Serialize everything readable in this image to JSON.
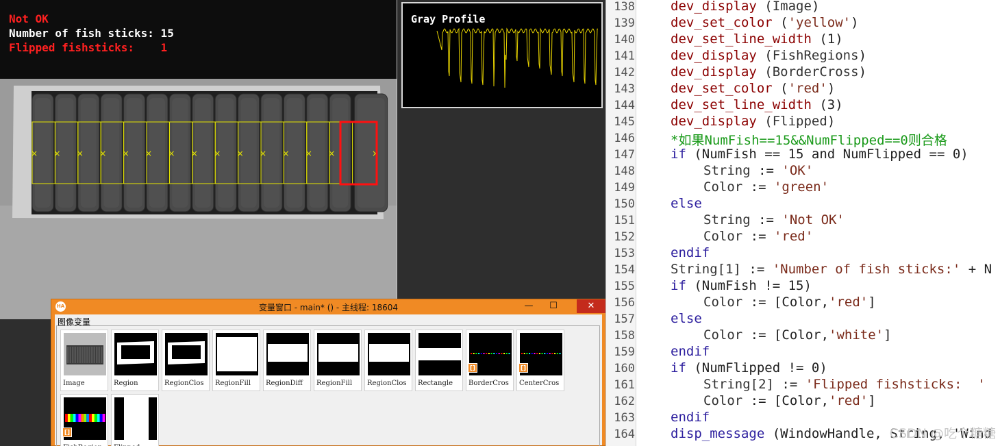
{
  "image_window": {
    "overlay_lines": [
      {
        "text": "Not OK",
        "color": "#ff2020"
      },
      {
        "text": "Number of fish sticks: 15",
        "color": "#ffffff"
      },
      {
        "text": "Flipped fishsticks:    1",
        "color": "#ff2020"
      }
    ],
    "fish_count": 15,
    "flipped_index": 14
  },
  "gray_profile": {
    "title": "Gray Profile",
    "line_color": "#e6d200"
  },
  "variable_window": {
    "title": "变量窗口 - main* () - 主线程: 18604",
    "minimize": "—",
    "maximize": "☐",
    "close": "✕",
    "group_label": "图像变量",
    "variables": [
      {
        "name": "Image",
        "kind": "image"
      },
      {
        "name": "Region",
        "kind": "region-small"
      },
      {
        "name": "RegionClos",
        "kind": "region-small"
      },
      {
        "name": "RegionFill",
        "kind": "region-big"
      },
      {
        "name": "RegionDiff",
        "kind": "band"
      },
      {
        "name": "RegionFill",
        "kind": "band"
      },
      {
        "name": "RegionClos",
        "kind": "band"
      },
      {
        "name": "Rectangle",
        "kind": "band-narrow"
      },
      {
        "name": "BorderCros",
        "kind": "dots",
        "badge": "[]"
      },
      {
        "name": "CenterCros",
        "kind": "dots",
        "badge": "[]"
      },
      {
        "name": "FishRegion",
        "kind": "colors",
        "badge": "[]"
      },
      {
        "name": "Flipped",
        "kind": "flipped"
      }
    ]
  },
  "editor": {
    "lines": [
      {
        "num": "138",
        "indent": 0,
        "parts": [
          [
            "fn",
            "dev_display"
          ],
          [
            "op",
            " ("
          ],
          [
            "var",
            "Image"
          ],
          [
            "op",
            ")"
          ]
        ]
      },
      {
        "num": "139",
        "indent": 0,
        "parts": [
          [
            "fn",
            "dev_set_color"
          ],
          [
            "op",
            " ("
          ],
          [
            "str",
            "'yellow'"
          ],
          [
            "op",
            ")"
          ]
        ]
      },
      {
        "num": "140",
        "indent": 0,
        "parts": [
          [
            "fn",
            "dev_set_line_width"
          ],
          [
            "op",
            " (1)"
          ]
        ]
      },
      {
        "num": "141",
        "indent": 0,
        "parts": [
          [
            "fn",
            "dev_display"
          ],
          [
            "op",
            " ("
          ],
          [
            "var",
            "FishRegions"
          ],
          [
            "op",
            ")"
          ]
        ]
      },
      {
        "num": "142",
        "indent": 0,
        "parts": [
          [
            "fn",
            "dev_display"
          ],
          [
            "op",
            " ("
          ],
          [
            "var",
            "BorderCross"
          ],
          [
            "op",
            ")"
          ]
        ]
      },
      {
        "num": "143",
        "indent": 0,
        "parts": [
          [
            "fn",
            "dev_set_color"
          ],
          [
            "op",
            " ("
          ],
          [
            "str",
            "'red'"
          ],
          [
            "op",
            ")"
          ]
        ]
      },
      {
        "num": "144",
        "indent": 0,
        "parts": [
          [
            "fn",
            "dev_set_line_width"
          ],
          [
            "op",
            " (3)"
          ]
        ]
      },
      {
        "num": "145",
        "indent": 0,
        "parts": [
          [
            "fn",
            "dev_display"
          ],
          [
            "op",
            " ("
          ],
          [
            "var",
            "Flipped"
          ],
          [
            "op",
            ")"
          ]
        ]
      },
      {
        "num": "146",
        "indent": 0,
        "parts": [
          [
            "cm",
            "*如果NumFish==15&&NumFlipped==0则合格"
          ]
        ]
      },
      {
        "num": "147",
        "indent": 0,
        "parts": [
          [
            "kw",
            "if"
          ],
          [
            "op",
            " (NumFish == 15 and NumFlipped == 0)"
          ]
        ]
      },
      {
        "num": "148",
        "indent": 1,
        "parts": [
          [
            "var",
            "String"
          ],
          [
            "op",
            " := "
          ],
          [
            "str",
            "'OK'"
          ]
        ]
      },
      {
        "num": "149",
        "indent": 1,
        "parts": [
          [
            "var",
            "Color"
          ],
          [
            "op",
            " := "
          ],
          [
            "str",
            "'green'"
          ]
        ]
      },
      {
        "num": "150",
        "indent": 0,
        "parts": [
          [
            "kw",
            "else"
          ]
        ]
      },
      {
        "num": "151",
        "indent": 1,
        "parts": [
          [
            "var",
            "String"
          ],
          [
            "op",
            " := "
          ],
          [
            "str",
            "'Not OK'"
          ]
        ]
      },
      {
        "num": "152",
        "indent": 1,
        "parts": [
          [
            "var",
            "Color"
          ],
          [
            "op",
            " := "
          ],
          [
            "str",
            "'red'"
          ]
        ]
      },
      {
        "num": "153",
        "indent": 0,
        "parts": [
          [
            "kw",
            "endif"
          ]
        ]
      },
      {
        "num": "154",
        "indent": 0,
        "parts": [
          [
            "var",
            "String[1]"
          ],
          [
            "op",
            " := "
          ],
          [
            "str",
            "'Number of fish sticks:'"
          ],
          [
            "op",
            " + N"
          ]
        ]
      },
      {
        "num": "155",
        "indent": 0,
        "parts": [
          [
            "kw",
            "if"
          ],
          [
            "op",
            " (NumFish != 15)"
          ]
        ]
      },
      {
        "num": "156",
        "indent": 1,
        "parts": [
          [
            "var",
            "Color"
          ],
          [
            "op",
            " := [Color,"
          ],
          [
            "str",
            "'red'"
          ],
          [
            "op",
            "]"
          ]
        ]
      },
      {
        "num": "157",
        "indent": 0,
        "parts": [
          [
            "kw",
            "else"
          ]
        ]
      },
      {
        "num": "158",
        "indent": 1,
        "parts": [
          [
            "var",
            "Color"
          ],
          [
            "op",
            " := [Color,"
          ],
          [
            "str",
            "'white'"
          ],
          [
            "op",
            "]"
          ]
        ]
      },
      {
        "num": "159",
        "indent": 0,
        "parts": [
          [
            "kw",
            "endif"
          ]
        ]
      },
      {
        "num": "160",
        "indent": 0,
        "parts": [
          [
            "kw",
            "if"
          ],
          [
            "op",
            " (NumFlipped != 0)"
          ]
        ]
      },
      {
        "num": "161",
        "indent": 1,
        "parts": [
          [
            "var",
            "String[2]"
          ],
          [
            "op",
            " := "
          ],
          [
            "str",
            "'Flipped fishsticks:  '"
          ]
        ]
      },
      {
        "num": "162",
        "indent": 1,
        "parts": [
          [
            "var",
            "Color"
          ],
          [
            "op",
            " := [Color,"
          ],
          [
            "str",
            "'red'"
          ],
          [
            "op",
            "]"
          ]
        ]
      },
      {
        "num": "163",
        "indent": 0,
        "parts": [
          [
            "kw",
            "endif"
          ]
        ]
      },
      {
        "num": "164",
        "indent": 0,
        "parts": [
          [
            "kw",
            "disp_message"
          ],
          [
            "op",
            " (WindowHandle, String, 'Wind"
          ]
        ]
      }
    ],
    "watermark": "CSDN @吃个糖糖"
  }
}
